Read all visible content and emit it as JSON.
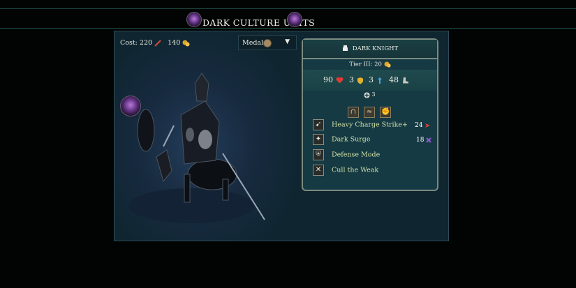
{
  "header": {
    "title": "DARK CULTURE UNITS"
  },
  "topbar": {
    "cost_label": "Cost:",
    "cost_primary": "220",
    "cost_secondary": "140",
    "medals_label": "Medals"
  },
  "unit": {
    "name": "DARK KNIGHT",
    "tier_label": "Tier III:",
    "tier_value": "20",
    "stats": {
      "health": "90",
      "defense": "3",
      "initiative": "3",
      "speed": "48"
    },
    "movement": "3",
    "abilities": [
      {
        "name": "Heavy Charge Strike+",
        "damage": "24",
        "damage_color": "#e8423a"
      },
      {
        "name": "Dark Surge",
        "damage": "18",
        "damage_color": "#8f5bd6"
      },
      {
        "name": "Defense Mode"
      },
      {
        "name": "Cull the Weak"
      }
    ]
  },
  "colors": {
    "accent": "#cfe0a6",
    "frame": "#7b8b80",
    "panel": "#0f2631"
  },
  "icons": [
    "lance-icon",
    "gold-coin-icon",
    "medal-icon",
    "chevron-down-icon",
    "fist-icon",
    "heart-icon",
    "shield-icon",
    "initiative-icon",
    "boot-icon",
    "movement-icon",
    "horseshoe-icon",
    "claw-icon",
    "gauntlet-icon"
  ]
}
